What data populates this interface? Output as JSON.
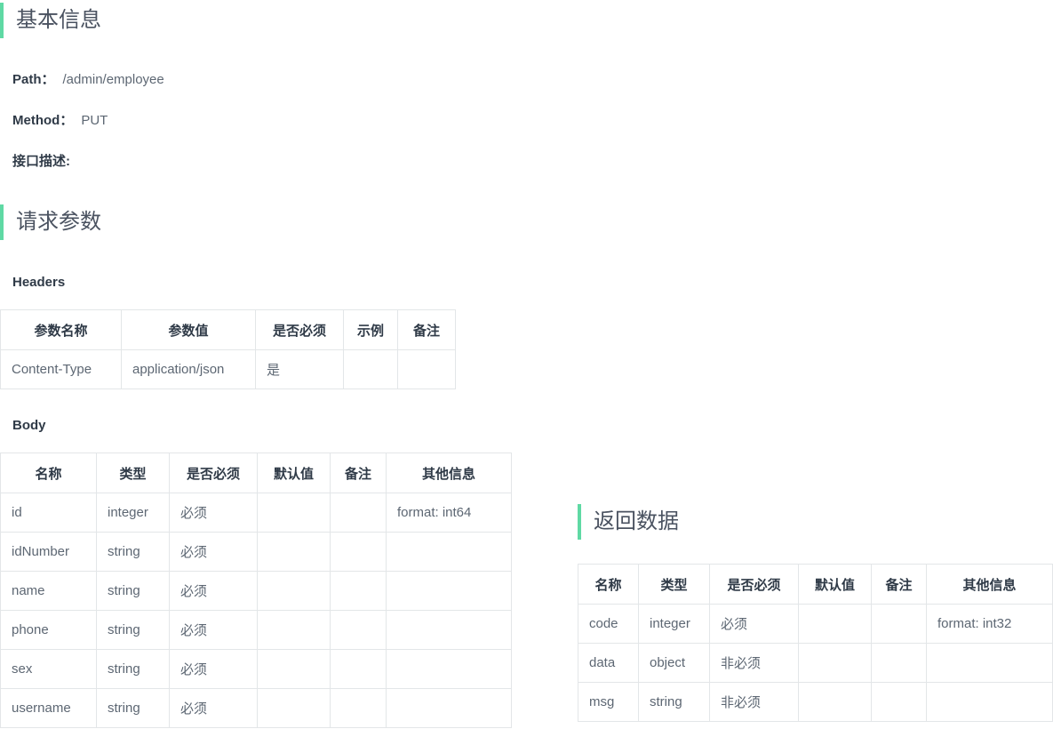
{
  "sections": {
    "basic_info": {
      "title": "基本信息"
    },
    "request_params": {
      "title": "请求参数"
    },
    "response_data": {
      "title": "返回数据"
    }
  },
  "basic_info": {
    "path_label": "Path：",
    "path_value": "/admin/employee",
    "method_label": "Method：",
    "method_value": "PUT",
    "description_label": "接口描述:",
    "description_value": ""
  },
  "request": {
    "headers_subtitle": "Headers",
    "headers_table": {
      "columns": [
        "参数名称",
        "参数值",
        "是否必须",
        "示例",
        "备注"
      ],
      "rows": [
        [
          "Content-Type",
          "application/json",
          "是",
          "",
          ""
        ]
      ]
    },
    "body_subtitle": "Body",
    "body_table": {
      "columns": [
        "名称",
        "类型",
        "是否必须",
        "默认值",
        "备注",
        "其他信息"
      ],
      "rows": [
        [
          "id",
          "integer",
          "必须",
          "",
          "",
          "format: int64"
        ],
        [
          "idNumber",
          "string",
          "必须",
          "",
          "",
          ""
        ],
        [
          "name",
          "string",
          "必须",
          "",
          "",
          ""
        ],
        [
          "phone",
          "string",
          "必须",
          "",
          "",
          ""
        ],
        [
          "sex",
          "string",
          "必须",
          "",
          "",
          ""
        ],
        [
          "username",
          "string",
          "必须",
          "",
          "",
          ""
        ]
      ]
    }
  },
  "response": {
    "table": {
      "columns": [
        "名称",
        "类型",
        "是否必须",
        "默认值",
        "备注",
        "其他信息"
      ],
      "rows": [
        [
          "code",
          "integer",
          "必须",
          "",
          "",
          "format: int32"
        ],
        [
          "data",
          "object",
          "非必须",
          "",
          "",
          ""
        ],
        [
          "msg",
          "string",
          "非必须",
          "",
          "",
          ""
        ]
      ]
    }
  },
  "colors": {
    "accent_green": "#5fd9a4",
    "border_gray": "#e3e6e8",
    "text_dark": "#2f3a47",
    "text_muted": "#5d6773"
  }
}
